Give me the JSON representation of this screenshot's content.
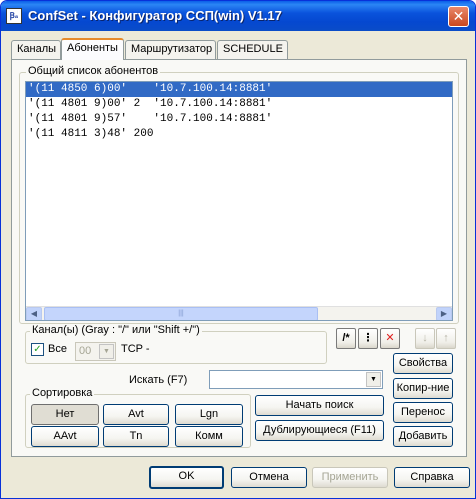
{
  "window": {
    "title": "ConfSet - Конфигуратор  ССП(win)  V1.17",
    "icon_text": "Ꞵ₈",
    "close_label": "✕"
  },
  "tabs": [
    {
      "label": "Каналы"
    },
    {
      "label": "Абоненты"
    },
    {
      "label": "Маршрутизатор"
    },
    {
      "label": "SCHEDULE"
    }
  ],
  "subscribers": {
    "group_label": "Общий  список  абонентов",
    "rows": [
      "'(11 4850 6)00'    '10.7.100.14:8881'",
      "'(11 4801 9)00' 2  '10.7.100.14:8881'",
      "'(11 4801 9)57'    '10.7.100.14:8881'",
      "'(11 4811 3)48' 200"
    ],
    "scroll_left": "◀",
    "scroll_right": "▶",
    "scroll_thumb_grip": "|||"
  },
  "channels": {
    "group_label": "Канал(ы)  (Gray : \"/\" или  \"Shift +/\")",
    "all_checkbox_mark": "✓",
    "all_label": "Все",
    "channel_value": "00",
    "channel_arrow": "▼",
    "protocol_label": "TCP -"
  },
  "toolbar": {
    "mask_icon": "/*",
    "sep_icon": "⋮",
    "delete_icon": "✕",
    "down_icon": "↓",
    "up_icon": "↑"
  },
  "search": {
    "label": "Искать (F7)",
    "value": "",
    "arrow": "▼",
    "start_button": "Начать  поиск",
    "duplicates_button": "Дублирующиеся (F11)"
  },
  "sort": {
    "group_label": "Сортировка",
    "buttons": [
      "Нет",
      "Avt",
      "Lgn",
      "AAvt",
      "Tn",
      "Комм"
    ]
  },
  "side_buttons": [
    "Свойства",
    "Копир-ние",
    "Перенос",
    "Добавить"
  ],
  "dialog_buttons": {
    "ok": "OK",
    "cancel": "Отмена",
    "apply": "Применить",
    "help": "Справка"
  },
  "colors": {
    "title_bar": "#0a53dc",
    "selection": "#316ac5",
    "delete_icon": "#e02020",
    "active_tab_accent": "#e68b2c"
  }
}
